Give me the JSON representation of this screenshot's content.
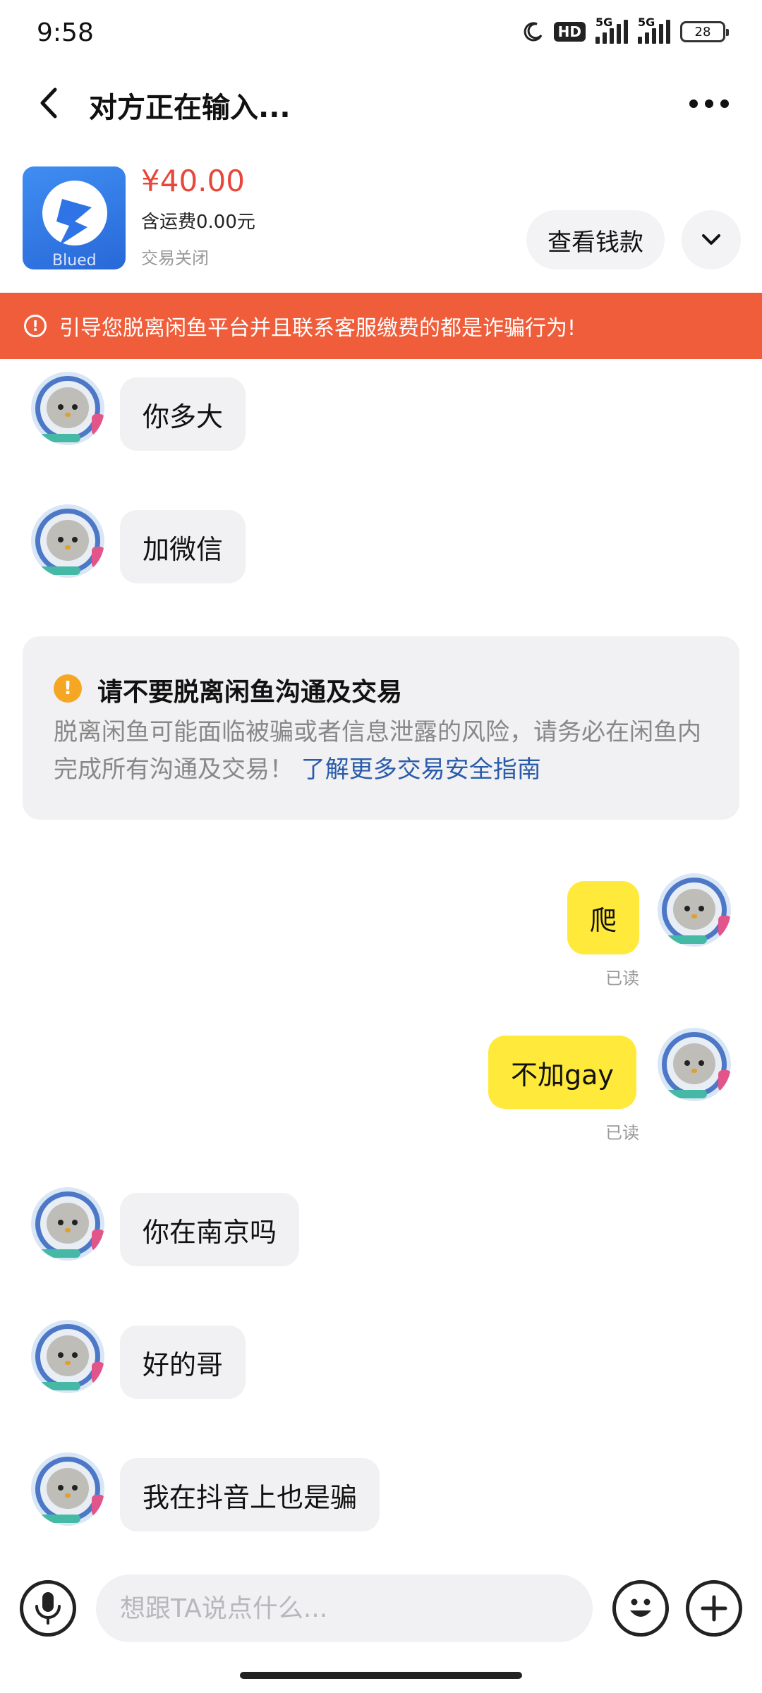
{
  "status_bar": {
    "time": "9:58",
    "hd_label": "HD",
    "network_1": "5G",
    "network_2": "5G",
    "battery": "28"
  },
  "header": {
    "title": "对方正在输入...",
    "back_icon": "chevron-left-icon",
    "more_icon": "more-dots-icon"
  },
  "product": {
    "price": "¥40.00",
    "shipping": "含运费0.00元",
    "status": "交易关闭",
    "thumb_text": "Blued",
    "view_button": "查看钱款",
    "expand_icon": "chevron-down-icon"
  },
  "banner": {
    "icon": "alert-circle-icon",
    "text": "引导您脱离闲鱼平台并且联系客服缴费的都是诈骗行为!",
    "color": "#ef5d3a"
  },
  "messages": [
    {
      "side": "in",
      "text": "你多大"
    },
    {
      "side": "in",
      "text": "加微信"
    },
    {
      "side": "out",
      "text": "爬",
      "read": "已读"
    },
    {
      "side": "out",
      "text": "不加gay",
      "read": "已读"
    },
    {
      "side": "in",
      "text": "你在南京吗"
    },
    {
      "side": "in",
      "text": "好的哥"
    },
    {
      "side": "in",
      "text": "我在抖音上也是骗"
    }
  ],
  "safety_notice": {
    "icon": "warning-icon",
    "title": "请不要脱离闲鱼沟通及交易",
    "body": "脱离闲鱼可能面临被骗或者信息泄露的风险，请务必在闲鱼内完成所有沟通及交易！",
    "link": "了解更多交易安全指南"
  },
  "input_bar": {
    "placeholder": "想跟TA说点什么...",
    "mic_icon": "microphone-icon",
    "emoji_icon": "emoji-icon",
    "plus_icon": "plus-icon"
  },
  "colors": {
    "price": "#e8473c",
    "outgoing_bubble": "#ffe93b",
    "incoming_bubble": "#f1f1f3",
    "link": "#2a5caa"
  }
}
